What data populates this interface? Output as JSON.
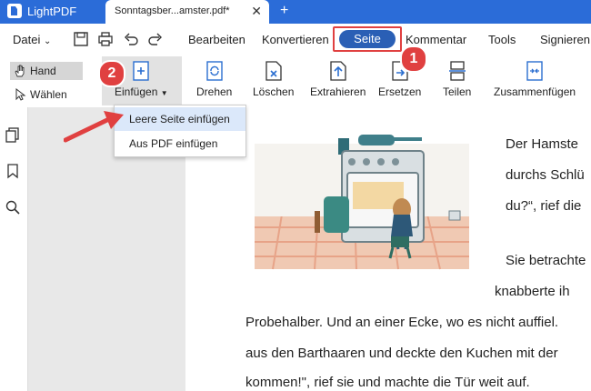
{
  "app": {
    "name": "LightPDF"
  },
  "tab": {
    "title": "Sonntagsber...amster.pdf*",
    "close": "✕",
    "add": "+"
  },
  "menu": {
    "file": "Datei",
    "items": [
      "Bearbeiten",
      "Konvertieren",
      "Seite",
      "Kommentar",
      "Tools",
      "Signieren"
    ],
    "active": "Seite"
  },
  "toolbar": {
    "hand": "Hand",
    "select": "Wählen",
    "tools": [
      "Einfügen",
      "Drehen",
      "Löschen",
      "Extrahieren",
      "Ersetzen",
      "Teilen",
      "Zusammenfügen"
    ]
  },
  "dropdown": {
    "items": [
      "Leere Seite einfügen",
      "Aus PDF einfügen"
    ],
    "highlighted": 0
  },
  "badges": [
    "1",
    "2"
  ],
  "document": {
    "lines": [
      "Der Hamste",
      "durchs Schlü",
      "du?“, rief die",
      "Sie betrachte",
      "knabberte ih",
      "Probehalber. Und an einer Ecke, wo es nicht auffiel.",
      "aus den Barthaaren und deckte den Kuchen mit der",
      "kommen!\", rief sie und machte die Tür weit auf."
    ]
  },
  "colors": {
    "accent": "#2b6cd8",
    "active_pill": "#2a5fb5",
    "annotation": "#e04040"
  }
}
